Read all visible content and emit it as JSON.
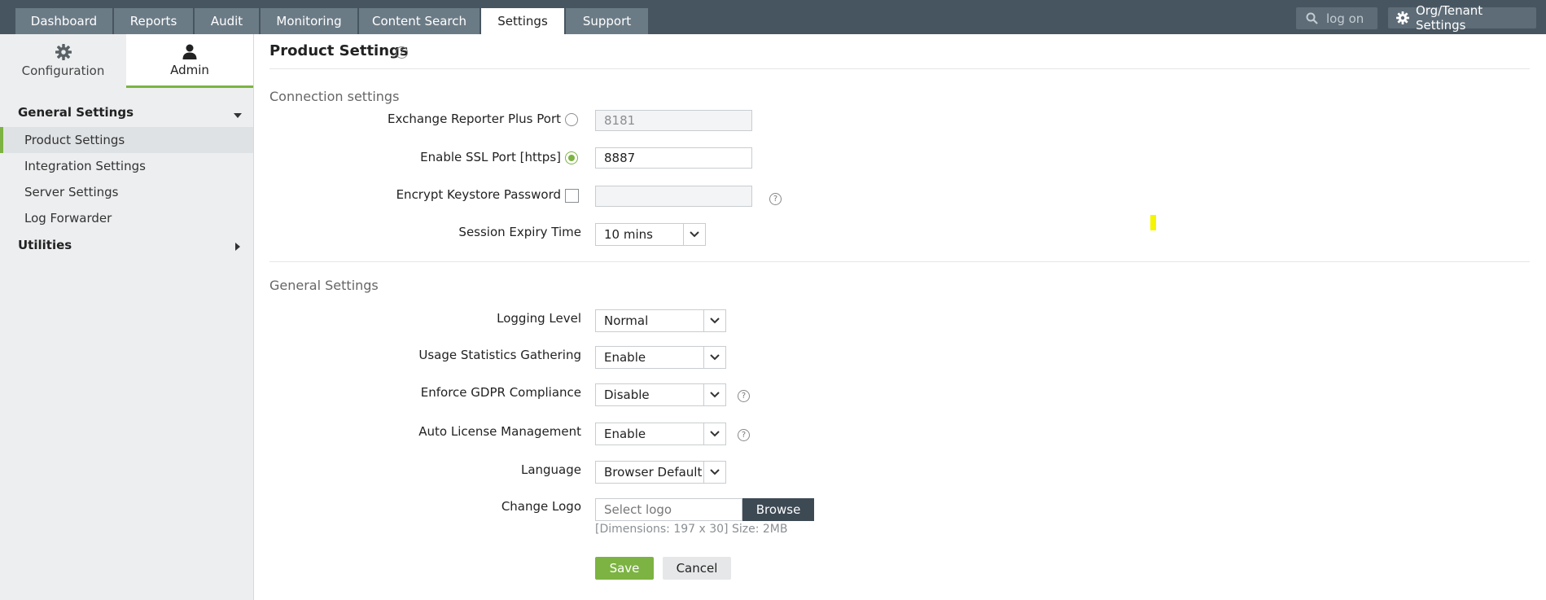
{
  "top_nav": {
    "tabs": [
      "Dashboard",
      "Reports",
      "Audit",
      "Monitoring",
      "Content Search",
      "Settings",
      "Support"
    ],
    "active_tab": "Settings",
    "search_placeholder": "log on",
    "org_button": "Org/Tenant Settings"
  },
  "sidebar": {
    "tabs": [
      {
        "label": "Configuration",
        "icon": "gear-icon"
      },
      {
        "label": "Admin",
        "icon": "user-icon"
      }
    ],
    "active_tab": "Admin",
    "groups": [
      {
        "label": "General Settings",
        "expanded": true,
        "items": [
          "Product Settings",
          "Integration Settings",
          "Server Settings",
          "Log Forwarder"
        ]
      },
      {
        "label": "Utilities",
        "expanded": false,
        "items": []
      }
    ],
    "active_item": "Product Settings"
  },
  "main": {
    "title": "Product Settings",
    "connection": {
      "title": "Connection settings",
      "port_label": "Exchange Reporter Plus Port",
      "port_value": "8181",
      "ssl_label": "Enable SSL Port [https]",
      "ssl_value": "8887",
      "keystore_label": "Encrypt Keystore Password",
      "keystore_value": "",
      "session_label": "Session Expiry Time",
      "session_value": "10 mins"
    },
    "general": {
      "title": "General Settings",
      "logging_label": "Logging Level",
      "logging_value": "Normal",
      "usage_label": "Usage Statistics Gathering",
      "usage_value": "Enable",
      "gdpr_label": "Enforce GDPR Compliance",
      "gdpr_value": "Disable",
      "license_label": "Auto License Management",
      "license_value": "Enable",
      "language_label": "Language",
      "language_value": "Browser Default",
      "logo_label": "Change Logo",
      "logo_placeholder": "Select logo",
      "browse_label": "Browse",
      "logo_hint": "[Dimensions: 197 x 30] Size: 2MB"
    },
    "save_label": "Save",
    "cancel_label": "Cancel"
  },
  "colors": {
    "topbar": "#475560",
    "accent": "#7cb342",
    "sidebar": "#eceeef"
  }
}
